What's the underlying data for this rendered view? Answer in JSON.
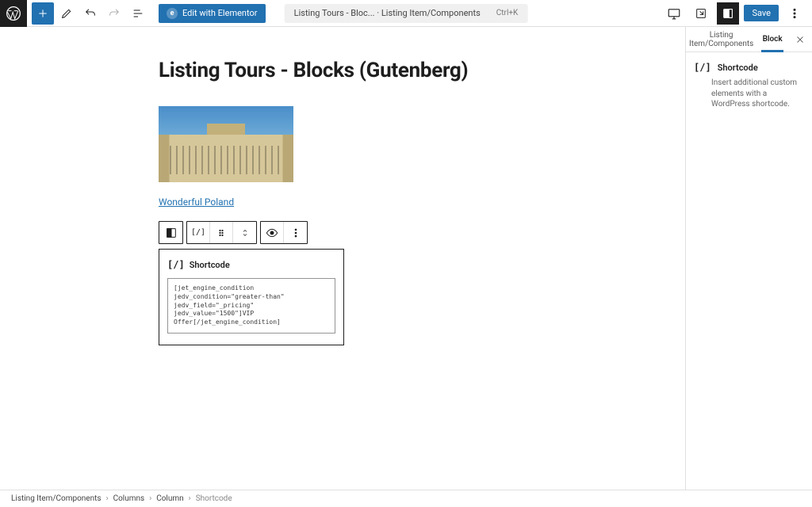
{
  "topbar": {
    "elementor_label": "Edit with Elementor",
    "doc_pill_title": "Listing Tours - Bloc... · Listing Item/Components",
    "doc_pill_shortcut": "Ctrl+K",
    "save_label": "Save"
  },
  "page": {
    "title": "Listing Tours - Blocks (Gutenberg)",
    "link_text": "Wonderful Poland"
  },
  "shortcode_block": {
    "label": "Shortcode",
    "icon_glyph": "[/]",
    "content": "[jet_engine_condition jedv_condition=\"greater-than\" jedv_field=\"_pricing\" jedv_value=\"1500\"]VIP Offer[/jet_engine_condition]"
  },
  "sidebar": {
    "tab1": "Listing Item/Components",
    "tab2": "Block",
    "block_name": "Shortcode",
    "block_desc": "Insert additional custom elements with a WordPress shortcode.",
    "icon_glyph": "[/]"
  },
  "breadcrumbs": {
    "c1": "Listing Item/Components",
    "c2": "Columns",
    "c3": "Column",
    "c4": "Shortcode",
    "sep": "›"
  }
}
